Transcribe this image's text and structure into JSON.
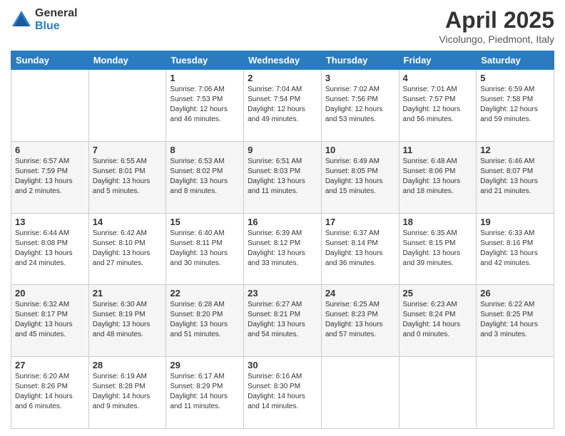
{
  "logo": {
    "general": "General",
    "blue": "Blue"
  },
  "header": {
    "month": "April 2025",
    "location": "Vicolungo, Piedmont, Italy"
  },
  "weekdays": [
    "Sunday",
    "Monday",
    "Tuesday",
    "Wednesday",
    "Thursday",
    "Friday",
    "Saturday"
  ],
  "weeks": [
    [
      {
        "day": "",
        "sunrise": "",
        "sunset": "",
        "daylight": ""
      },
      {
        "day": "",
        "sunrise": "",
        "sunset": "",
        "daylight": ""
      },
      {
        "day": "1",
        "sunrise": "Sunrise: 7:06 AM",
        "sunset": "Sunset: 7:53 PM",
        "daylight": "Daylight: 12 hours and 46 minutes."
      },
      {
        "day": "2",
        "sunrise": "Sunrise: 7:04 AM",
        "sunset": "Sunset: 7:54 PM",
        "daylight": "Daylight: 12 hours and 49 minutes."
      },
      {
        "day": "3",
        "sunrise": "Sunrise: 7:02 AM",
        "sunset": "Sunset: 7:56 PM",
        "daylight": "Daylight: 12 hours and 53 minutes."
      },
      {
        "day": "4",
        "sunrise": "Sunrise: 7:01 AM",
        "sunset": "Sunset: 7:57 PM",
        "daylight": "Daylight: 12 hours and 56 minutes."
      },
      {
        "day": "5",
        "sunrise": "Sunrise: 6:59 AM",
        "sunset": "Sunset: 7:58 PM",
        "daylight": "Daylight: 12 hours and 59 minutes."
      }
    ],
    [
      {
        "day": "6",
        "sunrise": "Sunrise: 6:57 AM",
        "sunset": "Sunset: 7:59 PM",
        "daylight": "Daylight: 13 hours and 2 minutes."
      },
      {
        "day": "7",
        "sunrise": "Sunrise: 6:55 AM",
        "sunset": "Sunset: 8:01 PM",
        "daylight": "Daylight: 13 hours and 5 minutes."
      },
      {
        "day": "8",
        "sunrise": "Sunrise: 6:53 AM",
        "sunset": "Sunset: 8:02 PM",
        "daylight": "Daylight: 13 hours and 8 minutes."
      },
      {
        "day": "9",
        "sunrise": "Sunrise: 6:51 AM",
        "sunset": "Sunset: 8:03 PM",
        "daylight": "Daylight: 13 hours and 11 minutes."
      },
      {
        "day": "10",
        "sunrise": "Sunrise: 6:49 AM",
        "sunset": "Sunset: 8:05 PM",
        "daylight": "Daylight: 13 hours and 15 minutes."
      },
      {
        "day": "11",
        "sunrise": "Sunrise: 6:48 AM",
        "sunset": "Sunset: 8:06 PM",
        "daylight": "Daylight: 13 hours and 18 minutes."
      },
      {
        "day": "12",
        "sunrise": "Sunrise: 6:46 AM",
        "sunset": "Sunset: 8:07 PM",
        "daylight": "Daylight: 13 hours and 21 minutes."
      }
    ],
    [
      {
        "day": "13",
        "sunrise": "Sunrise: 6:44 AM",
        "sunset": "Sunset: 8:08 PM",
        "daylight": "Daylight: 13 hours and 24 minutes."
      },
      {
        "day": "14",
        "sunrise": "Sunrise: 6:42 AM",
        "sunset": "Sunset: 8:10 PM",
        "daylight": "Daylight: 13 hours and 27 minutes."
      },
      {
        "day": "15",
        "sunrise": "Sunrise: 6:40 AM",
        "sunset": "Sunset: 8:11 PM",
        "daylight": "Daylight: 13 hours and 30 minutes."
      },
      {
        "day": "16",
        "sunrise": "Sunrise: 6:39 AM",
        "sunset": "Sunset: 8:12 PM",
        "daylight": "Daylight: 13 hours and 33 minutes."
      },
      {
        "day": "17",
        "sunrise": "Sunrise: 6:37 AM",
        "sunset": "Sunset: 8:14 PM",
        "daylight": "Daylight: 13 hours and 36 minutes."
      },
      {
        "day": "18",
        "sunrise": "Sunrise: 6:35 AM",
        "sunset": "Sunset: 8:15 PM",
        "daylight": "Daylight: 13 hours and 39 minutes."
      },
      {
        "day": "19",
        "sunrise": "Sunrise: 6:33 AM",
        "sunset": "Sunset: 8:16 PM",
        "daylight": "Daylight: 13 hours and 42 minutes."
      }
    ],
    [
      {
        "day": "20",
        "sunrise": "Sunrise: 6:32 AM",
        "sunset": "Sunset: 8:17 PM",
        "daylight": "Daylight: 13 hours and 45 minutes."
      },
      {
        "day": "21",
        "sunrise": "Sunrise: 6:30 AM",
        "sunset": "Sunset: 8:19 PM",
        "daylight": "Daylight: 13 hours and 48 minutes."
      },
      {
        "day": "22",
        "sunrise": "Sunrise: 6:28 AM",
        "sunset": "Sunset: 8:20 PM",
        "daylight": "Daylight: 13 hours and 51 minutes."
      },
      {
        "day": "23",
        "sunrise": "Sunrise: 6:27 AM",
        "sunset": "Sunset: 8:21 PM",
        "daylight": "Daylight: 13 hours and 54 minutes."
      },
      {
        "day": "24",
        "sunrise": "Sunrise: 6:25 AM",
        "sunset": "Sunset: 8:23 PM",
        "daylight": "Daylight: 13 hours and 57 minutes."
      },
      {
        "day": "25",
        "sunrise": "Sunrise: 6:23 AM",
        "sunset": "Sunset: 8:24 PM",
        "daylight": "Daylight: 14 hours and 0 minutes."
      },
      {
        "day": "26",
        "sunrise": "Sunrise: 6:22 AM",
        "sunset": "Sunset: 8:25 PM",
        "daylight": "Daylight: 14 hours and 3 minutes."
      }
    ],
    [
      {
        "day": "27",
        "sunrise": "Sunrise: 6:20 AM",
        "sunset": "Sunset: 8:26 PM",
        "daylight": "Daylight: 14 hours and 6 minutes."
      },
      {
        "day": "28",
        "sunrise": "Sunrise: 6:19 AM",
        "sunset": "Sunset: 8:28 PM",
        "daylight": "Daylight: 14 hours and 9 minutes."
      },
      {
        "day": "29",
        "sunrise": "Sunrise: 6:17 AM",
        "sunset": "Sunset: 8:29 PM",
        "daylight": "Daylight: 14 hours and 11 minutes."
      },
      {
        "day": "30",
        "sunrise": "Sunrise: 6:16 AM",
        "sunset": "Sunset: 8:30 PM",
        "daylight": "Daylight: 14 hours and 14 minutes."
      },
      {
        "day": "",
        "sunrise": "",
        "sunset": "",
        "daylight": ""
      },
      {
        "day": "",
        "sunrise": "",
        "sunset": "",
        "daylight": ""
      },
      {
        "day": "",
        "sunrise": "",
        "sunset": "",
        "daylight": ""
      }
    ]
  ]
}
